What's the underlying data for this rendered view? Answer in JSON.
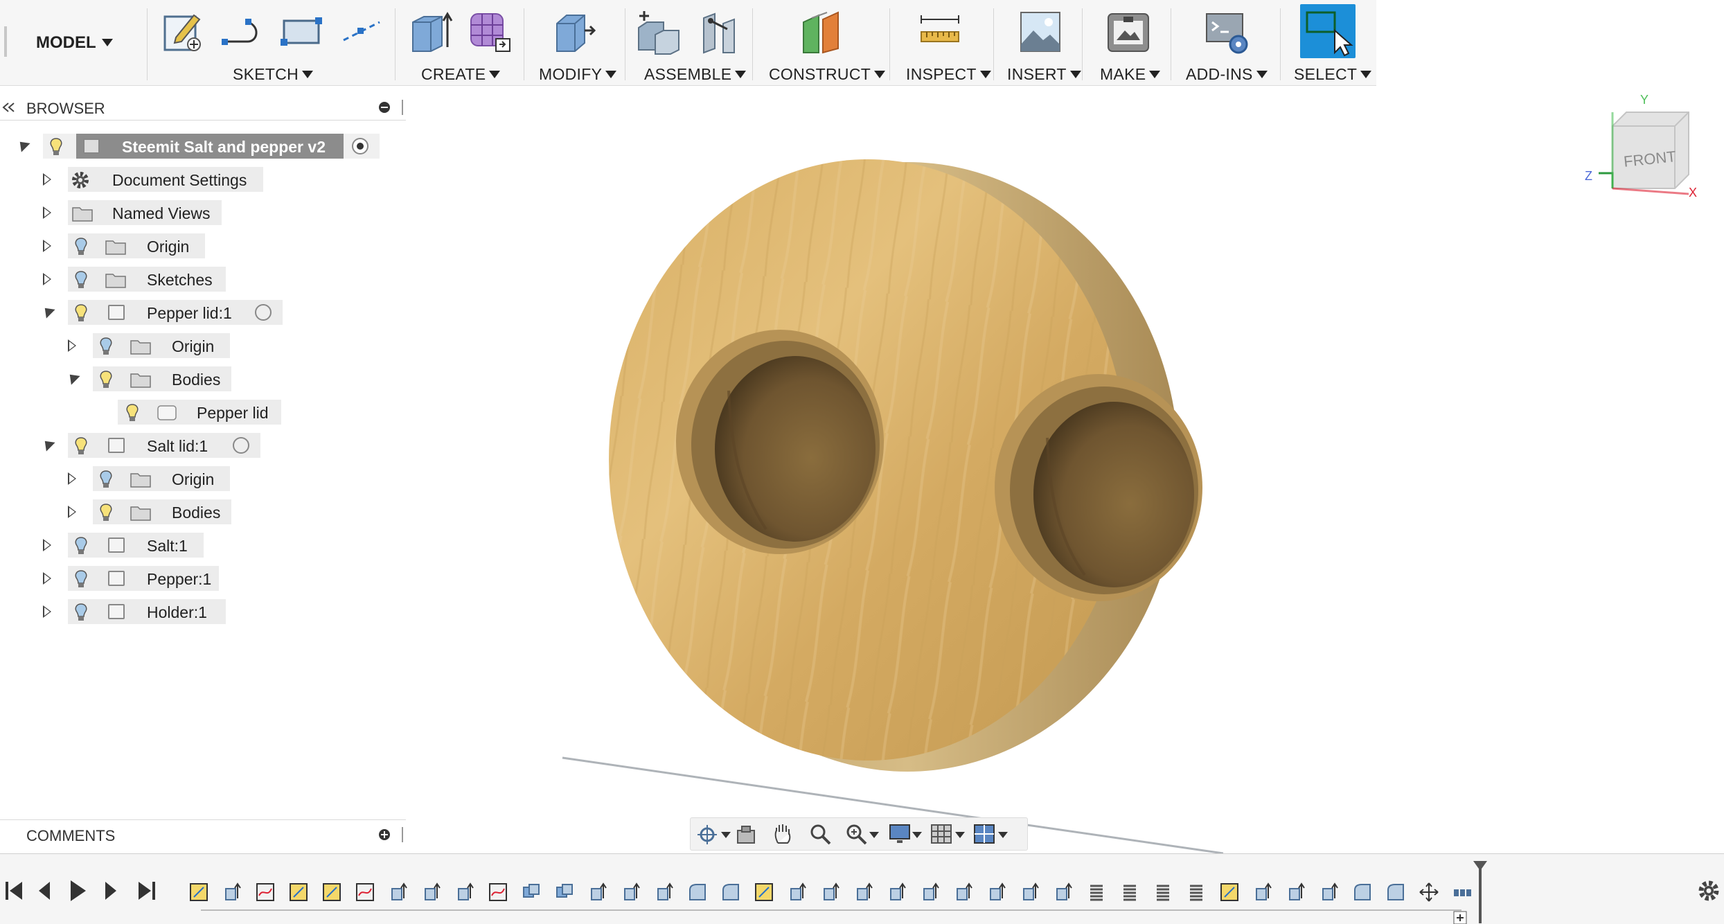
{
  "workspace": {
    "label": "MODEL"
  },
  "toolbar": {
    "groups": [
      {
        "label": "SKETCH"
      },
      {
        "label": "CREATE"
      },
      {
        "label": "MODIFY"
      },
      {
        "label": "ASSEMBLE"
      },
      {
        "label": "CONSTRUCT"
      },
      {
        "label": "INSPECT"
      },
      {
        "label": "INSERT"
      },
      {
        "label": "MAKE"
      },
      {
        "label": "ADD-INS"
      },
      {
        "label": "SELECT"
      }
    ],
    "icons": [
      "create-sketch-icon",
      "line-icon",
      "rectangle-icon",
      "construction-line-icon",
      "extrude-icon",
      "form-icon",
      "press-pull-icon",
      "new-component-icon",
      "joint-icon",
      "offset-plane-icon",
      "measure-icon",
      "insert-image-icon",
      "3d-print-icon",
      "scripts-addins-icon",
      "select-window-icon"
    ]
  },
  "browser": {
    "title": "BROWSER",
    "tree": [
      {
        "label": "Steemit Salt and pepper v2",
        "expanded": true,
        "selected": true
      },
      {
        "label": "Document Settings"
      },
      {
        "label": "Named Views"
      },
      {
        "label": "Origin"
      },
      {
        "label": "Sketches"
      },
      {
        "label": "Pepper lid:1",
        "expanded": true
      },
      {
        "label": "Origin"
      },
      {
        "label": "Bodies",
        "expanded": true
      },
      {
        "label": "Pepper lid"
      },
      {
        "label": "Salt lid:1",
        "expanded": true
      },
      {
        "label": "Origin"
      },
      {
        "label": "Bodies"
      },
      {
        "label": "Salt:1"
      },
      {
        "label": "Pepper:1"
      },
      {
        "label": "Holder:1"
      }
    ]
  },
  "comments": {
    "title": "COMMENTS"
  },
  "viewcube": {
    "face": "FRONT",
    "axes": {
      "x": "X",
      "y": "Y",
      "z": "Z"
    }
  },
  "colors": {
    "accent": "#1c8fd8",
    "wood_light": "#dcb56c",
    "wood_dark": "#a8834a",
    "toolbar_bg": "#f6f6f6"
  }
}
